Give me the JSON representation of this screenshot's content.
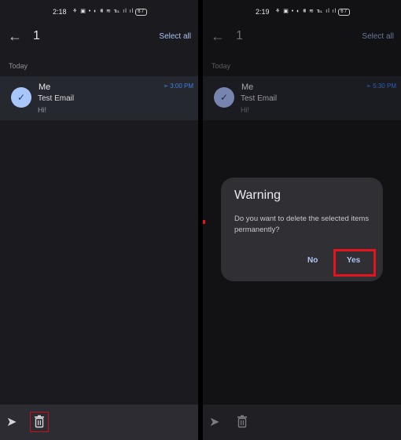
{
  "screens": [
    {
      "status_time": "2:18",
      "status_icons": "⚘ ▣ • ◐ ⩩ ≋ ℡ ıl ıl",
      "battery": "67",
      "back_icon": "arrow-left-icon",
      "selected_count": "1",
      "select_all_label": "Select all",
      "section_label": "Today",
      "email": {
        "sender": "Me",
        "subject": "Test Email",
        "snippet": "Hi!",
        "scheduled_time": "3:00 PM",
        "selected": true
      },
      "bottom_actions": [
        "send",
        "delete"
      ]
    },
    {
      "status_time": "2:19",
      "status_icons": "⚘ ▣ • ◐ ⩩ ≋ ℡ ıl ıl",
      "battery": "67",
      "back_icon": "arrow-left-icon",
      "selected_count": "1",
      "select_all_label": "Select all",
      "section_label": "Today",
      "email": {
        "sender": "Me",
        "subject": "Test Email",
        "snippet": "Hi!",
        "scheduled_time": "5:30 PM",
        "selected": true
      },
      "bottom_actions": [
        "send",
        "delete"
      ],
      "dialog": {
        "title": "Warning",
        "message": "Do you want to delete the selected items permanently?",
        "no_label": "No",
        "yes_label": "Yes"
      }
    }
  ],
  "colors": {
    "accent": "#a8c2f2",
    "highlight": "#e5141c",
    "scheduled": "#3d7fe0"
  }
}
